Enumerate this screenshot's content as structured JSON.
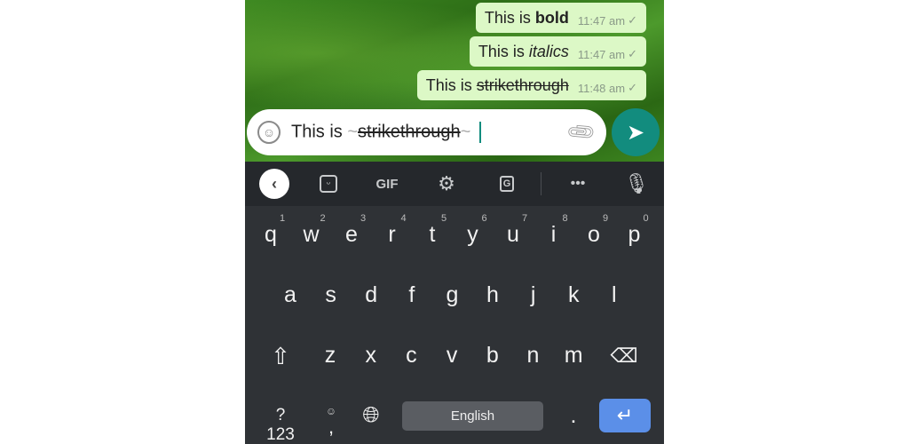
{
  "messages": [
    {
      "prefix": "This is ",
      "styled": "bold",
      "style": "bold",
      "time": "11:47 am"
    },
    {
      "prefix": "This is ",
      "styled": "italics",
      "style": "italic",
      "time": "11:47 am"
    },
    {
      "prefix": "This is ",
      "styled": "strikethrough",
      "style": "strike",
      "time": "11:48 am"
    }
  ],
  "composer": {
    "prefix": "This is ",
    "tilde": "~",
    "styled": "strikethrough"
  },
  "toolbar": {
    "gif": "GIF"
  },
  "keys": {
    "row1": [
      "q",
      "w",
      "e",
      "r",
      "t",
      "y",
      "u",
      "i",
      "o",
      "p"
    ],
    "hints": [
      "1",
      "2",
      "3",
      "4",
      "5",
      "6",
      "7",
      "8",
      "9",
      "0"
    ],
    "row2": [
      "a",
      "s",
      "d",
      "f",
      "g",
      "h",
      "j",
      "k",
      "l"
    ],
    "row3": [
      "z",
      "x",
      "c",
      "v",
      "b",
      "n",
      "m"
    ],
    "symbols": "?123",
    "comma": ",",
    "period": ".",
    "space": "English"
  },
  "colors": {
    "bubble": "#dcf8c6",
    "send": "#128c7e",
    "enter": "#5b8fe8",
    "keyboard": "#2f3236"
  }
}
